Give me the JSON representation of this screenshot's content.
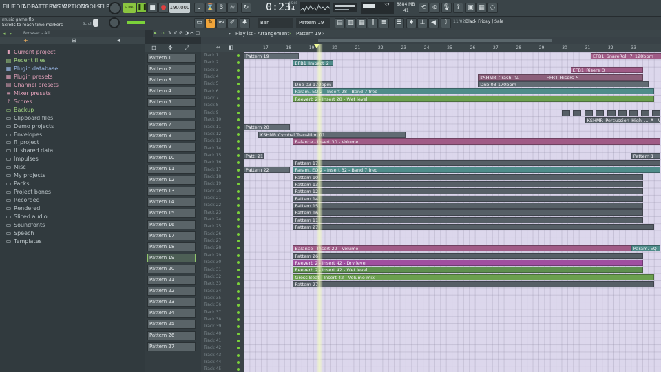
{
  "menu": [
    "FILE",
    "EDIT",
    "ADD",
    "PATTERNS",
    "VIEW",
    "OPTIONS",
    "TOOLS",
    "HELP"
  ],
  "transport": {
    "song_label": "SONG",
    "tempo": "190.000",
    "time": "0:23",
    "time_small": "14",
    "time_mode": "M:S:CS"
  },
  "cpu": {
    "value": "32",
    "mem": "8884 MB",
    "poly": "41"
  },
  "hint": {
    "line1": "music game.flp",
    "line2": "Scrolls to reach time markers",
    "scroll_label": "Scroll"
  },
  "snap": "Bar",
  "pattern_selector": "Pattern 19",
  "news": {
    "num": "11/02",
    "text": "Black Friday | Sale"
  },
  "browser": {
    "header": "Browser - All",
    "items": [
      {
        "label": "Current project",
        "icon": "project-icon",
        "color": "#e0a0b8",
        "glyph": "▮"
      },
      {
        "label": "Recent files",
        "icon": "recent-icon",
        "color": "#a0d080",
        "glyph": "▤"
      },
      {
        "label": "Plugin database",
        "icon": "plugin-database-icon",
        "color": "#9ab8e8",
        "glyph": "▦"
      },
      {
        "label": "Plugin presets",
        "icon": "plugin-presets-icon",
        "color": "#e0a0b8",
        "glyph": "▦"
      },
      {
        "label": "Channel presets",
        "icon": "channel-presets-icon",
        "color": "#e0a0b8",
        "glyph": "▤"
      },
      {
        "label": "Mixer presets",
        "icon": "mixer-presets-icon",
        "color": "#e0a0b8",
        "glyph": "≡"
      },
      {
        "label": "Scores",
        "icon": "scores-icon",
        "color": "#e0a0b8",
        "glyph": "♪"
      },
      {
        "label": "Backup",
        "icon": "folder-icon",
        "color": "#a0d080",
        "glyph": "▭"
      },
      {
        "label": "Clipboard files",
        "icon": "folder-icon",
        "color": "#b8c2c6",
        "glyph": "▭"
      },
      {
        "label": "Demo projects",
        "icon": "folder-icon",
        "color": "#b8c2c6",
        "glyph": "▭"
      },
      {
        "label": "Envelopes",
        "icon": "folder-icon",
        "color": "#b8c2c6",
        "glyph": "▭"
      },
      {
        "label": "fl_project",
        "icon": "folder-icon",
        "color": "#b8c2c6",
        "glyph": "▭"
      },
      {
        "label": "IL shared data",
        "icon": "folder-icon",
        "color": "#b8c2c6",
        "glyph": "▭"
      },
      {
        "label": "Impulses",
        "icon": "folder-icon",
        "color": "#b8c2c6",
        "glyph": "▭"
      },
      {
        "label": "Misc",
        "icon": "folder-icon",
        "color": "#b8c2c6",
        "glyph": "▭"
      },
      {
        "label": "My projects",
        "icon": "folder-icon",
        "color": "#b8c2c6",
        "glyph": "▭"
      },
      {
        "label": "Packs",
        "icon": "folder-icon",
        "color": "#b8c2c6",
        "glyph": "▭"
      },
      {
        "label": "Project bones",
        "icon": "folder-icon",
        "color": "#b8c2c6",
        "glyph": "▭"
      },
      {
        "label": "Recorded",
        "icon": "folder-icon",
        "color": "#b8c2c6",
        "glyph": "▭"
      },
      {
        "label": "Rendered",
        "icon": "folder-icon",
        "color": "#b8c2c6",
        "glyph": "▭"
      },
      {
        "label": "Sliced audio",
        "icon": "folder-icon",
        "color": "#b8c2c6",
        "glyph": "▭"
      },
      {
        "label": "Soundfonts",
        "icon": "folder-icon",
        "color": "#b8c2c6",
        "glyph": "▭"
      },
      {
        "label": "Speech",
        "icon": "folder-icon",
        "color": "#b8c2c6",
        "glyph": "▭"
      },
      {
        "label": "Templates",
        "icon": "folder-icon",
        "color": "#b8c2c6",
        "glyph": "▭"
      }
    ]
  },
  "patterns": [
    "Pattern 1",
    "Pattern 2",
    "Pattern 3",
    "Pattern 4",
    "Pattern 5",
    "Pattern 6",
    "Pattern 7",
    "Pattern 8",
    "Pattern 9",
    "Pattern 10",
    "Pattern 11",
    "Pattern 12",
    "Pattern 13",
    "Pattern 14",
    "Pattern 15",
    "Pattern 16",
    "Pattern 17",
    "Pattern 18",
    "Pattern 19",
    "Pattern 20",
    "Pattern 21",
    "Pattern 22",
    "Pattern 23",
    "Pattern 24",
    "Pattern 25",
    "Pattern 26",
    "Pattern 27"
  ],
  "selected_pattern": "Pattern 19",
  "playlist": {
    "title": "Playlist - Arrangement",
    "pattern": "Pattern 19",
    "ruler": [
      "17",
      "18",
      "19",
      "20",
      "21",
      "22",
      "23",
      "24",
      "25",
      "26",
      "27",
      "28",
      "29",
      "30",
      "31",
      "32",
      "33"
    ],
    "tracks": [
      "Track 1",
      "Track 2",
      "Track 3",
      "Track 4",
      "Track 5",
      "Track 6",
      "Track 7",
      "Track 8",
      "Track 9",
      "Track 10",
      "Track 11",
      "Track 12",
      "Track 13",
      "Track 14",
      "Track 15",
      "Track 16",
      "Track 17",
      "Track 18",
      "Track 19",
      "Track 20",
      "Track 21",
      "Track 22",
      "Track 23",
      "Track 24",
      "Track 25",
      "Track 26",
      "Track 27",
      "Track 28",
      "Track 29",
      "Track 30",
      "Track 31",
      "Track 32",
      "Track 33",
      "Track 34",
      "Track 35",
      "Track 36",
      "Track 37",
      "Track 38",
      "Track 39",
      "Track 40",
      "Track 41",
      "Track 42",
      "Track 43",
      "Track 44",
      "Track 45"
    ],
    "clips": [
      {
        "t": 0,
        "s": 0,
        "e": 9.5,
        "c": "gray",
        "label": "Pattern 19"
      },
      {
        "t": 0,
        "s": 60,
        "e": 76,
        "c": "pink",
        "label": "EFB1_SnareRoll_7_128bpm"
      },
      {
        "t": 1,
        "s": 8.5,
        "e": 15.5,
        "c": "teal",
        "label": "EFB1_Impact_2"
      },
      {
        "t": 2,
        "s": 56.5,
        "e": 69,
        "c": "pink",
        "label": "EFB1_Risers_3"
      },
      {
        "t": 3,
        "s": 40.5,
        "e": 55,
        "c": "mauve",
        "label": "KSHMR_Crash_04"
      },
      {
        "t": 3,
        "s": 52,
        "e": 69,
        "c": "mauve",
        "label": "EFB1_Risers_5"
      },
      {
        "t": 4,
        "s": 40.5,
        "e": 70,
        "c": "gray",
        "label": "Dnb 03 170bpm"
      },
      {
        "t": 4,
        "s": 8.5,
        "e": 15.5,
        "c": "gray",
        "label": "Dnb 03 170bpm"
      },
      {
        "t": 5,
        "s": 8.5,
        "e": 71,
        "c": "teal",
        "label": "Param. EQ 2 - Insert 28 - Band 7 freq"
      },
      {
        "t": 6,
        "s": 8.5,
        "e": 71,
        "c": "green",
        "label": "Reeverb 2 - Insert 28 - Wet level"
      },
      {
        "t": 9,
        "s": 59,
        "e": 72,
        "c": "dgray",
        "label": "KSHMR_Percussion_High_..._A - Volume multiplier"
      },
      {
        "t": 10,
        "s": 0,
        "e": 8,
        "c": "gray",
        "label": "Pattern 20"
      },
      {
        "t": 11,
        "s": 2.5,
        "e": 28,
        "c": "gray",
        "label": "KSHMR Cymbal Transition 01"
      },
      {
        "t": 12,
        "s": 8.5,
        "e": 72,
        "c": "pink",
        "label": "Balance - Insert 30 - Volume"
      },
      {
        "t": 14,
        "s": 0,
        "e": 3.5,
        "c": "gray",
        "label": "Patt. 21"
      },
      {
        "t": 14,
        "s": 67,
        "e": 72,
        "c": "gray",
        "label": "Pattern 1"
      },
      {
        "t": 15,
        "s": 8.5,
        "e": 72,
        "c": "dgray",
        "label": "Pattern 17"
      },
      {
        "t": 16,
        "s": 0,
        "e": 8,
        "c": "gray",
        "label": "Pattern 22"
      },
      {
        "t": 16,
        "s": 8.5,
        "e": 72,
        "c": "teal",
        "label": "Param. EQ 2 - Insert 32 - Band 7 freq"
      },
      {
        "t": 17,
        "s": 8.5,
        "e": 69,
        "c": "dgray",
        "label": "Pattern 10"
      },
      {
        "t": 18,
        "s": 8.5,
        "e": 69,
        "c": "dgray",
        "label": "Pattern 13"
      },
      {
        "t": 19,
        "s": 8.5,
        "e": 69,
        "c": "dgray",
        "label": "Pattern 12"
      },
      {
        "t": 20,
        "s": 8.5,
        "e": 69,
        "c": "dgray",
        "label": "Pattern 14"
      },
      {
        "t": 21,
        "s": 8.5,
        "e": 69,
        "c": "dgray",
        "label": "Pattern 15"
      },
      {
        "t": 22,
        "s": 8.5,
        "e": 69,
        "c": "dgray",
        "label": "Pattern 16"
      },
      {
        "t": 23,
        "s": 8.5,
        "e": 69,
        "c": "dgray",
        "label": "Pattern 11"
      },
      {
        "t": 24,
        "s": 8.5,
        "e": 71,
        "c": "dgray",
        "label": "Pattern 27"
      },
      {
        "t": 27,
        "s": 8.5,
        "e": 67,
        "c": "pink",
        "label": "Balance - Insert 29 - Volume"
      },
      {
        "t": 27,
        "s": 67,
        "e": 72,
        "c": "teal",
        "label": "Param. EQ"
      },
      {
        "t": 28,
        "s": 8.5,
        "e": 69,
        "c": "dgray",
        "label": "Pattern 26"
      },
      {
        "t": 29,
        "s": 8.5,
        "e": 69,
        "c": "magenta",
        "label": "Reeverb 2 - Insert 42 - Dry level"
      },
      {
        "t": 30,
        "s": 8.5,
        "e": 69,
        "c": "olive",
        "label": "Reeverb 2 - Insert 42 - Wet level"
      },
      {
        "t": 31,
        "s": 8.5,
        "e": 71,
        "c": "green",
        "label": "Gross Beat - Insert 42 - Volume mix"
      },
      {
        "t": 32,
        "s": 8.5,
        "e": 71,
        "c": "dgray",
        "label": "Pattern 27"
      }
    ]
  }
}
